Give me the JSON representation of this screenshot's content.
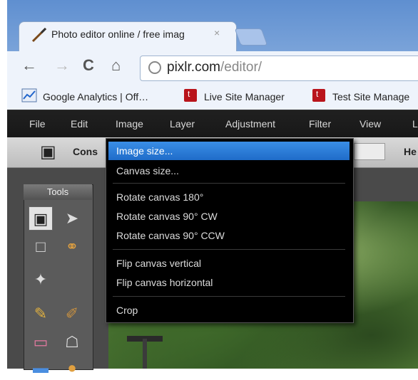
{
  "browser": {
    "tab_title": "Photo editor online / free imag",
    "tab_close": "×",
    "url_host": "pixlr.com",
    "url_path": "/editor/",
    "bookmarks": [
      {
        "label": "Google Analytics | Off…"
      },
      {
        "label": "Live Site Manager"
      },
      {
        "label": "Test Site Manage"
      }
    ],
    "nav_icons": [
      "back-icon",
      "forward-icon",
      "reload-icon",
      "home-icon"
    ]
  },
  "app": {
    "menu": [
      "File",
      "Edit",
      "Image",
      "Layer",
      "Adjustment",
      "Filter",
      "View",
      "L"
    ],
    "option_bar": {
      "constrain_label": "Cons",
      "right_label": "He"
    },
    "tools_title": "Tools",
    "image_menu": {
      "groups": [
        [
          "Image size...",
          "Canvas size..."
        ],
        [
          "Rotate canvas 180°",
          "Rotate canvas 90° CW",
          "Rotate canvas 90° CCW"
        ],
        [
          "Flip canvas vertical",
          "Flip canvas horizontal"
        ],
        [
          "Crop"
        ]
      ],
      "selected": "Image size..."
    }
  },
  "colors": {
    "selection": "#2a7ed8",
    "menubar": "#1c1c1c",
    "browser_frame": "#7aa3d9"
  }
}
